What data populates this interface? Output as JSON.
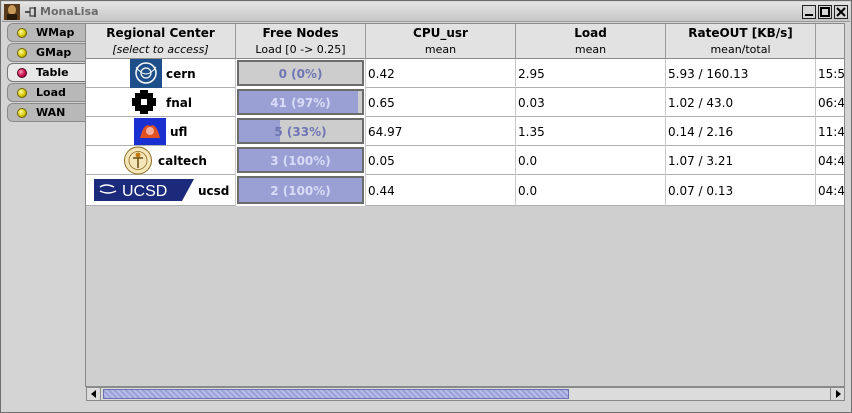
{
  "window": {
    "title": "MonaLisa"
  },
  "tabs": [
    {
      "label": "WMap",
      "active": false
    },
    {
      "label": "GMap",
      "active": false
    },
    {
      "label": "Table",
      "active": true
    },
    {
      "label": "Load",
      "active": false
    },
    {
      "label": "WAN",
      "active": false
    }
  ],
  "table": {
    "columns": [
      {
        "title": "Regional Center",
        "subtitle": "[select to access]"
      },
      {
        "title": "Free Nodes",
        "subtitle": "Load [0 -> 0.25]"
      },
      {
        "title": "CPU_usr",
        "subtitle": "mean"
      },
      {
        "title": "Load",
        "subtitle": "mean"
      },
      {
        "title": "RateOUT [KB/s]",
        "subtitle": "mean/total"
      }
    ],
    "rows": [
      {
        "center": "cern",
        "logo": "cern-logo-icon",
        "free_nodes": "0 (0%)",
        "free_fraction": 0.0,
        "cpu_usr": "0.42",
        "load": "2.95",
        "rate_out": "5.93 / 160.13",
        "next_col": "15:5"
      },
      {
        "center": "fnal",
        "logo": "fnal-logo-icon",
        "free_nodes": "41 (97%)",
        "free_fraction": 0.97,
        "cpu_usr": "0.65",
        "load": "0.03",
        "rate_out": "1.02 / 43.0",
        "next_col": "06:4"
      },
      {
        "center": "ufl",
        "logo": "ufl-logo-icon",
        "free_nodes": "5 (33%)",
        "free_fraction": 0.33,
        "cpu_usr": "64.97",
        "load": "1.35",
        "rate_out": "0.14 / 2.16",
        "next_col": "11:4"
      },
      {
        "center": "caltech",
        "logo": "caltech-logo-icon",
        "free_nodes": "3 (100%)",
        "free_fraction": 1.0,
        "cpu_usr": "0.05",
        "load": "0.0",
        "rate_out": "1.07 / 3.21",
        "next_col": "04:4"
      },
      {
        "center": "ucsd",
        "logo": "ucsd-logo-icon",
        "logo_text": "UCSD",
        "free_nodes": "2 (100%)",
        "free_fraction": 1.0,
        "cpu_usr": "0.44",
        "load": "0.0",
        "rate_out": "0.07 / 0.13",
        "next_col": "04:4"
      }
    ]
  },
  "colors": {
    "bar_fill": "#9aa0d4",
    "bar_track": "#cdcdcd",
    "active_tab_dot": "#c4004a",
    "tab_dot": "#d6c200"
  }
}
